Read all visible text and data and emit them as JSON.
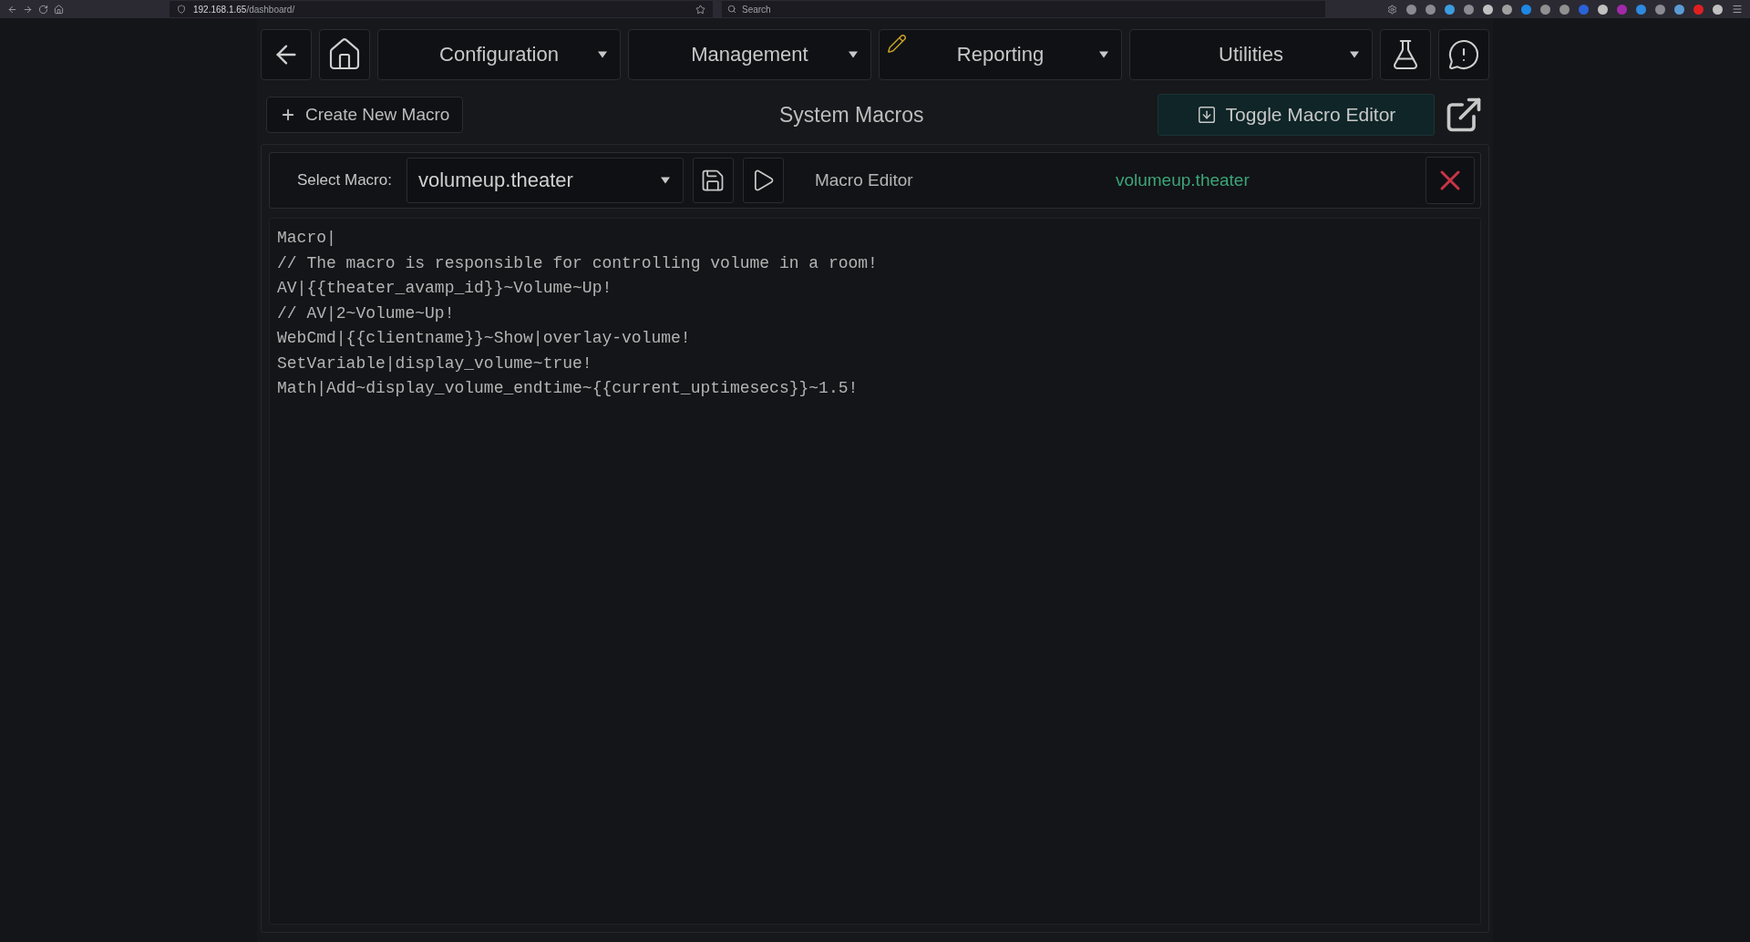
{
  "browser": {
    "url_host": "192.168.1.65",
    "url_path": "/dashboard/",
    "search": {
      "placeholder": "Search"
    }
  },
  "nav": {
    "menus": [
      {
        "label": "Configuration",
        "kind": "plain"
      },
      {
        "label": "Management",
        "kind": "plain"
      },
      {
        "label": "Reporting",
        "kind": "marked"
      },
      {
        "label": "Utilities",
        "kind": "plain"
      }
    ]
  },
  "toolbar": {
    "create_button": "Create New Macro",
    "title": "System Macros",
    "toggle_button": "Toggle Macro Editor"
  },
  "editor": {
    "select_label": "Select Macro:",
    "selected_macro": "volumeup.theater",
    "heading": "Macro Editor",
    "macro_name": "volumeup.theater",
    "lines": [
      "Macro|",
      "// The macro is responsible for controlling volume in a room!",
      "AV|{{theater_avamp_id}}~Volume~Up!",
      "// AV|2~Volume~Up!",
      "WebCmd|{{clientname}}~Show|overlay-volume!",
      "SetVariable|display_volume~true!",
      "Math|Add~display_volume_endtime~{{current_uptimesecs}}~1.5!"
    ]
  }
}
